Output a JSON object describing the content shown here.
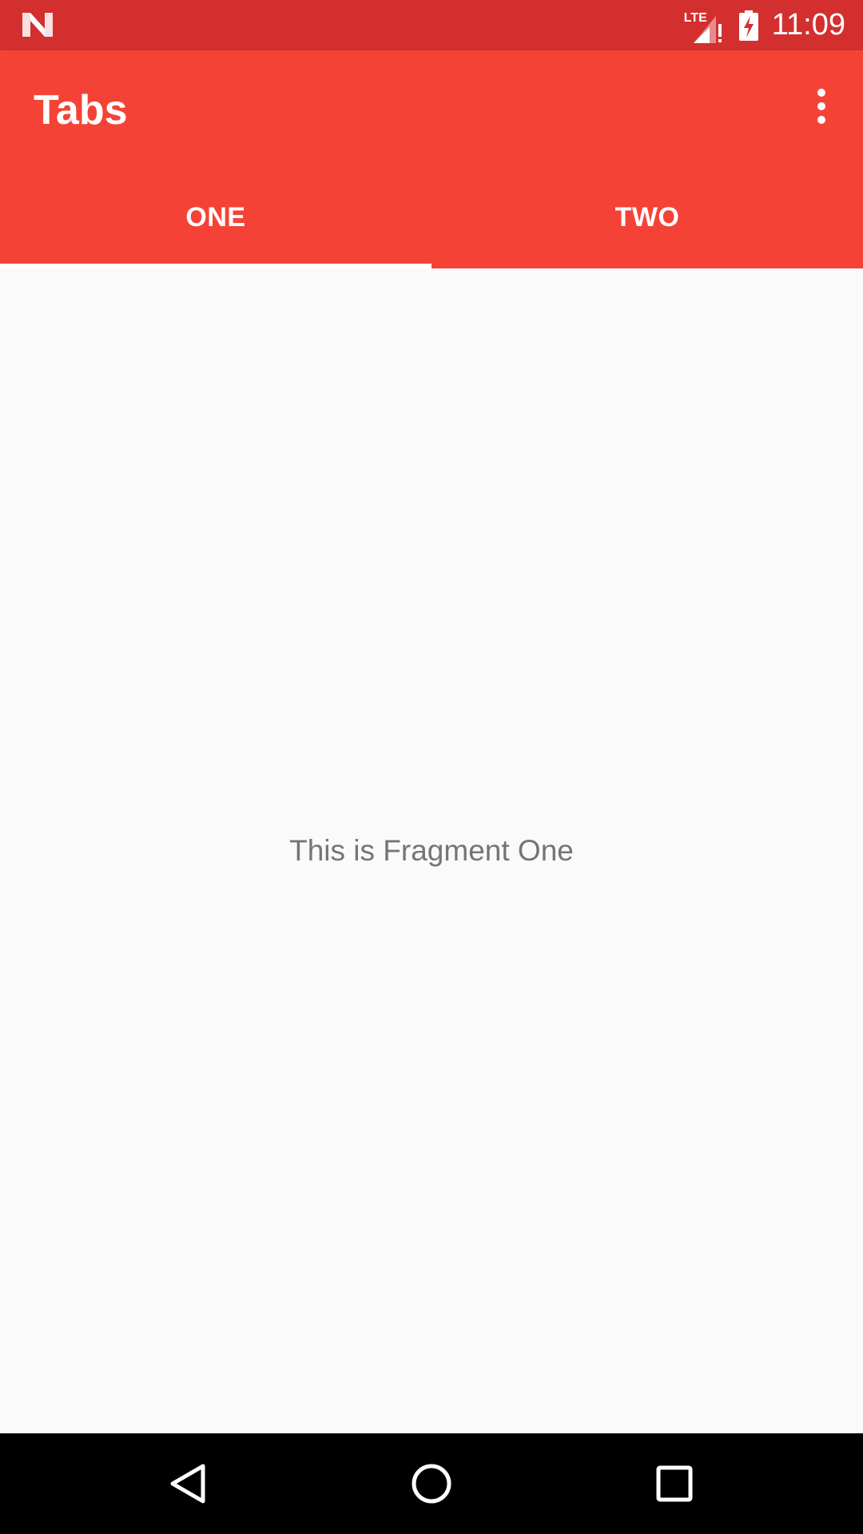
{
  "status_bar": {
    "network_label": "LTE",
    "time": "11:09",
    "notification_icon": "n-logo-icon"
  },
  "app_bar": {
    "title": "Tabs",
    "overflow_icon": "more-vert-icon"
  },
  "tabs": [
    {
      "label": "ONE",
      "selected": true
    },
    {
      "label": "TWO",
      "selected": false
    }
  ],
  "content": {
    "fragment_text": "This is Fragment One"
  },
  "colors": {
    "status_bar": "#d32f2f",
    "primary": "#f44336",
    "indicator": "#ffffff",
    "background": "#fafafa",
    "body_text": "#757575"
  },
  "nav_bar": {
    "icons": [
      "back-icon",
      "home-icon",
      "recents-icon"
    ]
  }
}
